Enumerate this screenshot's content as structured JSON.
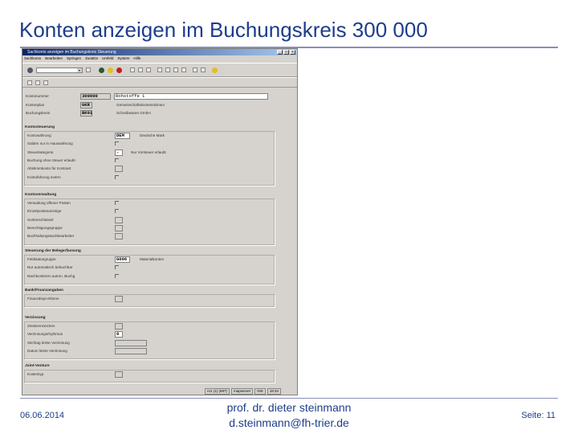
{
  "slide": {
    "title": "Konten anzeigen im Buchungskreis 300 000",
    "date": "06.06.2014",
    "author": "prof. dr. dieter steinmann",
    "email": "d.steinmann@fh-trier.de",
    "page": "Seite: 11"
  },
  "window": {
    "title": "Sachkonto anzeigen im Buchungskreis Steuerung",
    "menu": [
      "Sachkonto",
      "Bearbeiten",
      "Springen",
      "Zusätze",
      "Umfeld",
      "System",
      "Hilfe"
    ],
    "header_fields": [
      {
        "label": "Kontonummer",
        "value": "300000",
        "desc": "Rohstoffe 1"
      },
      {
        "label": "Kontenplan",
        "value": "GKR",
        "desc": "Gemeinschaftskontenrahmen"
      },
      {
        "label": "Buchungskreis",
        "value": "BK01",
        "desc": "Schreibwaren GmbH"
      }
    ],
    "groups": [
      {
        "title": "Kontosteuerung",
        "rows": [
          {
            "label": "Kontowährung",
            "type": "field",
            "value": "DEM",
            "desc": "Deutsche Mark"
          },
          {
            "label": "Salden nur in Hauswährung",
            "type": "check",
            "checked": true
          },
          {
            "label": "Steuerkategorie",
            "type": "field",
            "value": "-",
            "desc": "Nur Vorsteuer erlaubt"
          },
          {
            "label": "Buchung ohne Steuer erlaubt",
            "type": "check",
            "checked": false
          },
          {
            "label": "Abstimmkonto für Kontoart",
            "type": "field",
            "value": ""
          },
          {
            "label": "Kontoführung extern",
            "type": "check",
            "checked": false
          }
        ]
      },
      {
        "title": "Kontoverwaltung",
        "rows": [
          {
            "label": "Verwaltung offener Posten",
            "type": "check",
            "checked": false
          },
          {
            "label": "Einzelpostenanzeige",
            "type": "check",
            "checked": false
          },
          {
            "label": "Sortierschlüssel",
            "type": "field",
            "value": ""
          },
          {
            "label": "Berechtigungsgruppe",
            "type": "field",
            "value": ""
          },
          {
            "label": "Buchhaltungssachbearbeiter",
            "type": "field",
            "value": ""
          }
        ]
      },
      {
        "title": "Steuerung der Belegerfassung",
        "rows": [
          {
            "label": "Feldstatusgruppe",
            "type": "field",
            "value": "G006",
            "desc": "Materialkonten"
          },
          {
            "label": "Nur automatisch bebuchbar",
            "type": "check",
            "checked": true
          },
          {
            "label": "Nachkontieren autom. Buchg",
            "type": "check",
            "checked": false
          }
        ]
      },
      {
        "title": "Bank/Finanzangaben",
        "rows": [
          {
            "label": "Finanzdispo-Ebene",
            "type": "field",
            "value": ""
          }
        ]
      },
      {
        "title": "Verzinsung",
        "rows": [
          {
            "label": "Zinskennzeichen",
            "type": "field",
            "value": ""
          },
          {
            "label": "Verzinsungsrhythmus",
            "type": "field",
            "value": "0"
          },
          {
            "label": "Stichtag letzte Verzinsung",
            "type": "field",
            "value": "",
            "wide": true
          },
          {
            "label": "Datum letzte Verzinsung",
            "type": "field",
            "value": "",
            "wide": true
          }
        ]
      },
      {
        "title": "Joint-Venture",
        "rows": [
          {
            "label": "Kostentyp",
            "type": "field",
            "value": ""
          }
        ]
      }
    ],
    "status": [
      "AI1 (1) (697)",
      "mapserver",
      "INS",
      "18:34"
    ]
  }
}
